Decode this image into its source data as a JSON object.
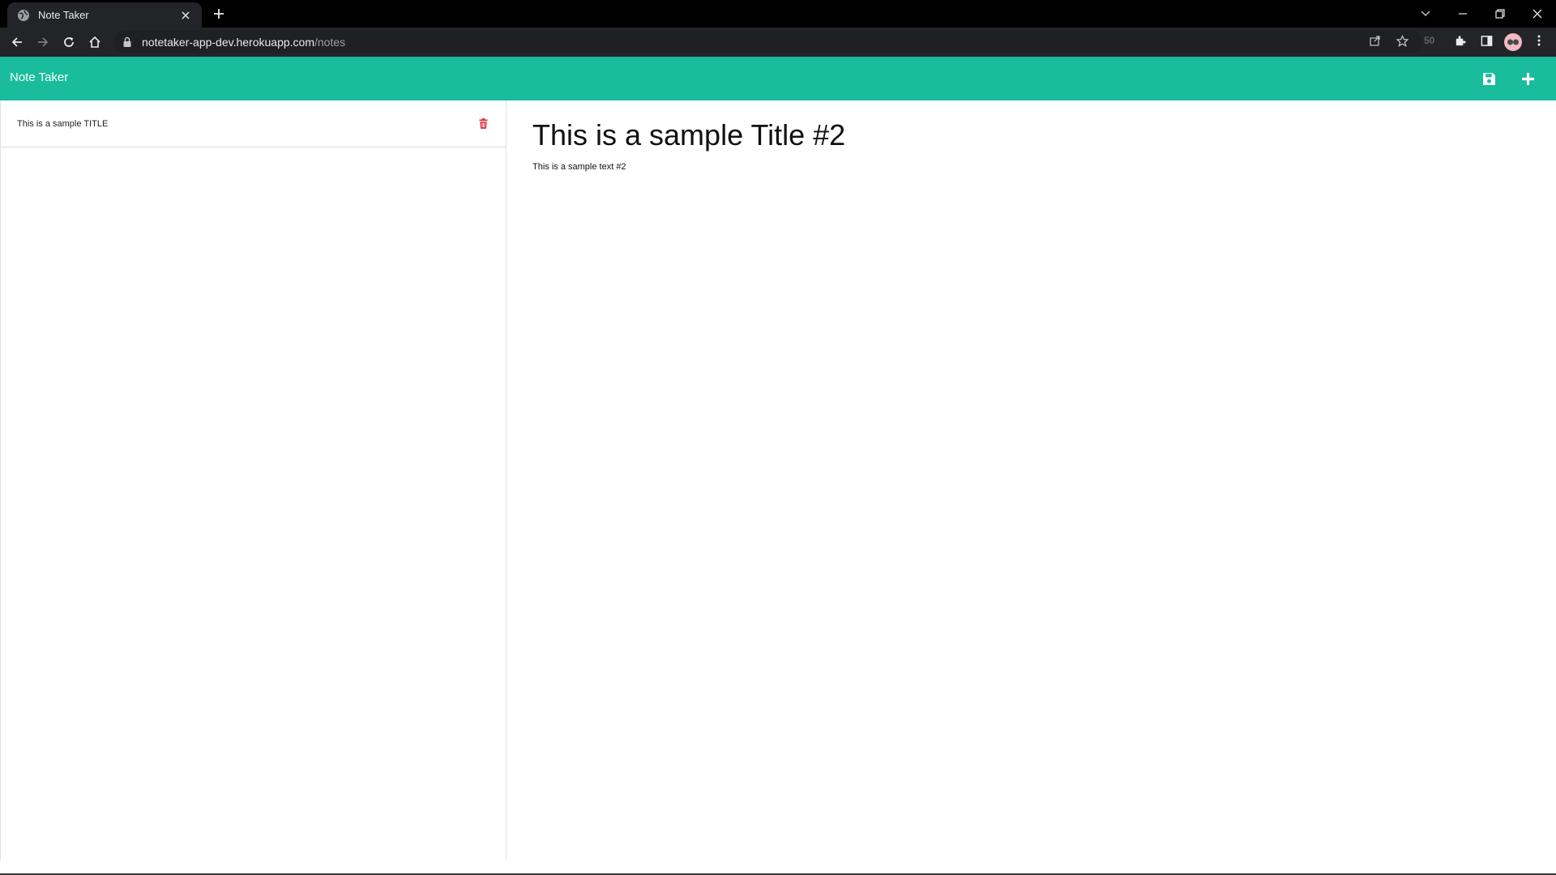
{
  "browser": {
    "tab_title": "Note Taker",
    "url_host": "notetaker-app-dev.herokuapp.com",
    "url_path": "/notes",
    "extension_count": "50"
  },
  "app": {
    "brand": "Note Taker",
    "accent_color": "#19bc9c",
    "delete_color": "#dc3545"
  },
  "notes": [
    {
      "title": "This is a sample TITLE"
    }
  ],
  "editor": {
    "title": "This is a sample Title #2",
    "text": "This is a sample text #2"
  }
}
